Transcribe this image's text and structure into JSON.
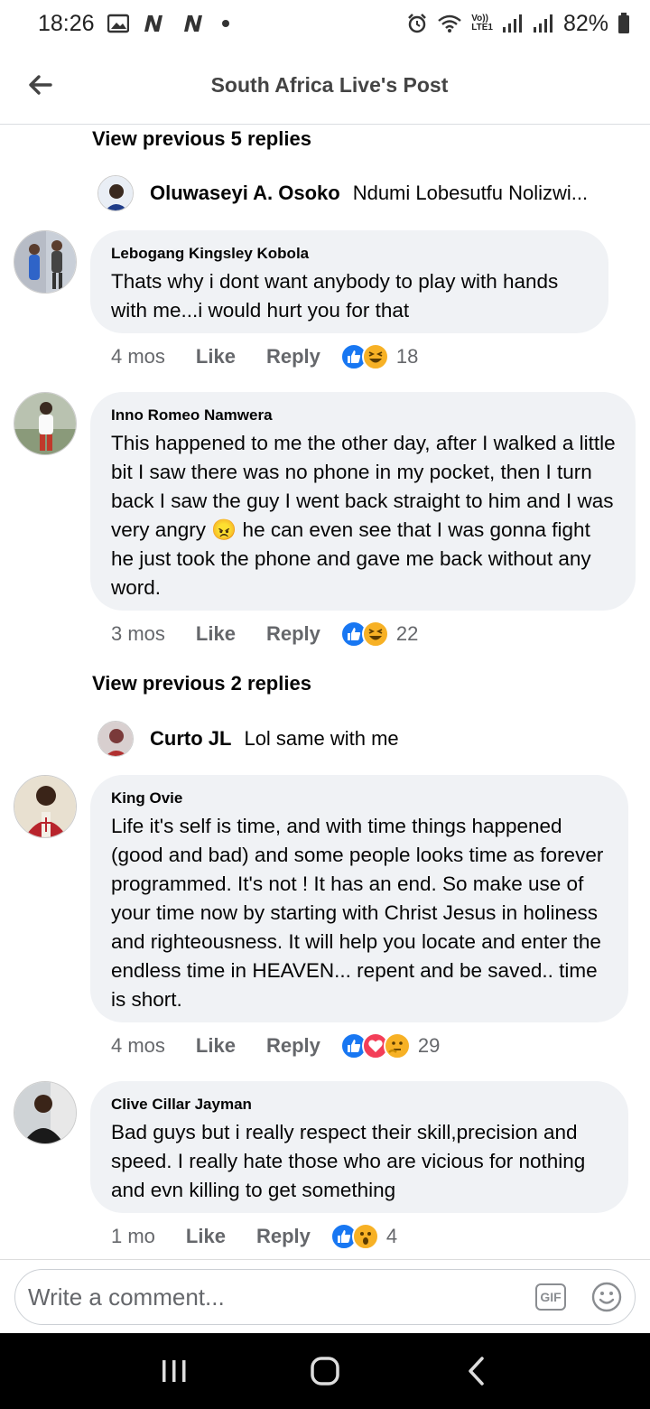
{
  "status_bar": {
    "time": "18:26",
    "battery": "82%",
    "lte_label": "LTE1",
    "volte_label": "Vo))"
  },
  "header": {
    "title": "South Africa Live's Post"
  },
  "thread1": {
    "view_previous": "View previous 5 replies",
    "preview_reply": {
      "name": "Oluwaseyi A. Osoko",
      "text": "Ndumi Lobesutfu Nolizwi..."
    }
  },
  "comments": [
    {
      "name": "Lebogang Kingsley Kobola",
      "text": "Thats why i dont want anybody to play with hands with me...i would hurt you for that",
      "time": "4 mos",
      "like": "Like",
      "reply": "Reply",
      "reactions": [
        "like",
        "haha"
      ],
      "count": "18"
    },
    {
      "name": "Inno Romeo Namwera",
      "text": "This happened to me the other day, after I walked a little bit I saw there was no phone in my pocket, then I turn back I saw the guy I went back straight to him and I was very angry 😠 he can even see that I was gonna fight he just took the phone and gave me back without any word.",
      "time": "3 mos",
      "like": "Like",
      "reply": "Reply",
      "reactions": [
        "like",
        "haha"
      ],
      "count": "22"
    },
    {
      "name": "King Ovie",
      "text": "Life it's self is time, and with time things happened (good and bad) and some people  looks time as forever programmed. It's not ! It has an end. So make use of your time now by starting with Christ Jesus in holiness and righteousness. It will help you locate and enter the endless time in HEAVEN... repent and be saved.. time is short.",
      "time": "4 mos",
      "like": "Like",
      "reply": "Reply",
      "reactions": [
        "like",
        "love",
        "thinking"
      ],
      "count": "29"
    },
    {
      "name": "Clive Cillar Jayman",
      "text": "Bad guys but i really respect their skill,precision and speed. I really hate those who are vicious for nothing and evn killing to get something",
      "time": "1 mo",
      "like": "Like",
      "reply": "Reply",
      "reactions": [
        "like",
        "wow"
      ],
      "count": "4"
    }
  ],
  "thread2": {
    "view_previous": "View previous 2 replies",
    "preview_reply": {
      "name": "Curto JL",
      "text": "Lol same with me"
    }
  },
  "composer": {
    "placeholder": "Write a comment...",
    "gif_label": "GIF"
  },
  "colors": {
    "like_blue": "#1877f2",
    "haha_yellow": "#f7b125",
    "love_red": "#f33e58",
    "bubble_bg": "#f0f2f5",
    "meta_gray": "#65676b"
  }
}
